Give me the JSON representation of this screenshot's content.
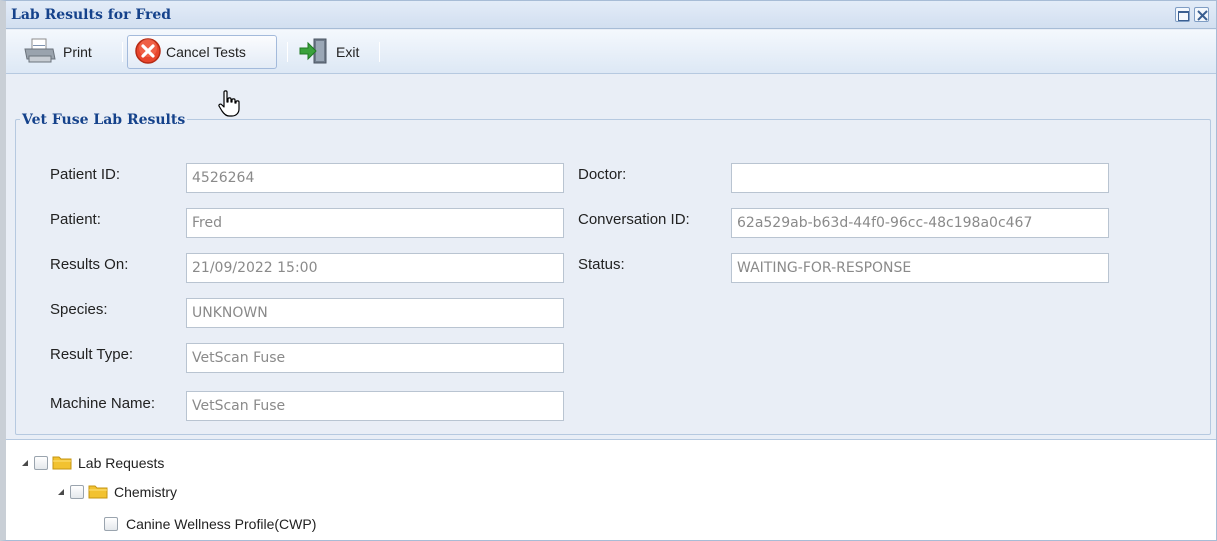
{
  "window": {
    "title": "Lab Results for Fred"
  },
  "toolbar": {
    "print_label": "Print",
    "cancel_label": "Cancel Tests",
    "exit_label": "Exit"
  },
  "form": {
    "legend": "Vet Fuse Lab Results",
    "left": [
      {
        "label": "Patient ID:",
        "value": "4526264"
      },
      {
        "label": "Patient:",
        "value": "Fred"
      },
      {
        "label": "Results On:",
        "value": "21/09/2022 15:00"
      },
      {
        "label": "Species:",
        "value": "UNKNOWN"
      },
      {
        "label": "Result Type:",
        "value": "VetScan Fuse"
      },
      {
        "label": "Machine Name:",
        "value": "VetScan Fuse"
      }
    ],
    "right": [
      {
        "label": "Doctor:",
        "value": ""
      },
      {
        "label": "Conversation ID:",
        "value": "62a529ab-b63d-44f0-96cc-48c198a0c467"
      },
      {
        "label": "Status:",
        "value": "WAITING-FOR-RESPONSE"
      }
    ]
  },
  "tree": {
    "root": "Lab Requests",
    "group": "Chemistry",
    "item": "Canine Wellness Profile(CWP)"
  },
  "colors": {
    "title": "#15428b",
    "cancel_icon": "#e8452c",
    "folder": "#f2c230",
    "exit_arrow": "#3aa23c"
  }
}
